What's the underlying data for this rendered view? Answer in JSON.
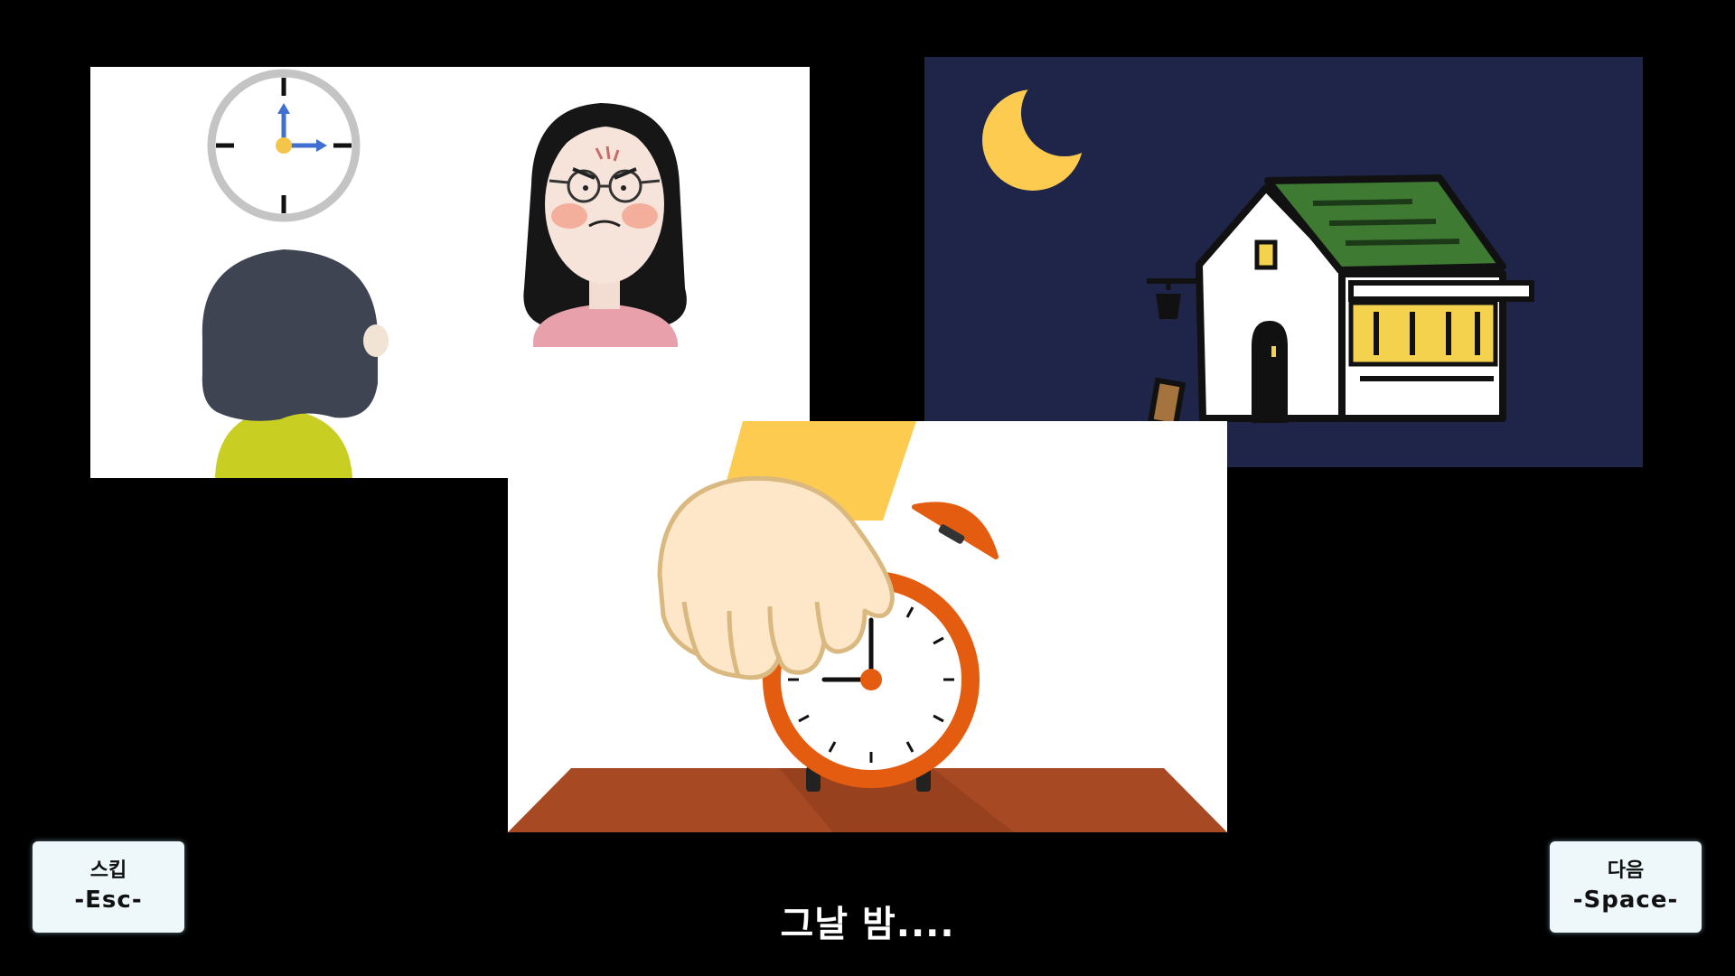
{
  "scene": {
    "caption": "그날 밤...."
  },
  "controls": {
    "skip": {
      "label": "스킵",
      "key": "-Esc-"
    },
    "next": {
      "label": "다음",
      "key": "-Space-"
    }
  },
  "colors": {
    "background": "#000000",
    "night_sky": "#1f2549",
    "moon": "#fccb4f",
    "roof": "#3f7a33",
    "clock_orange": "#e45c10",
    "table": "#a74a24",
    "button_bg": "#eef8fb"
  }
}
